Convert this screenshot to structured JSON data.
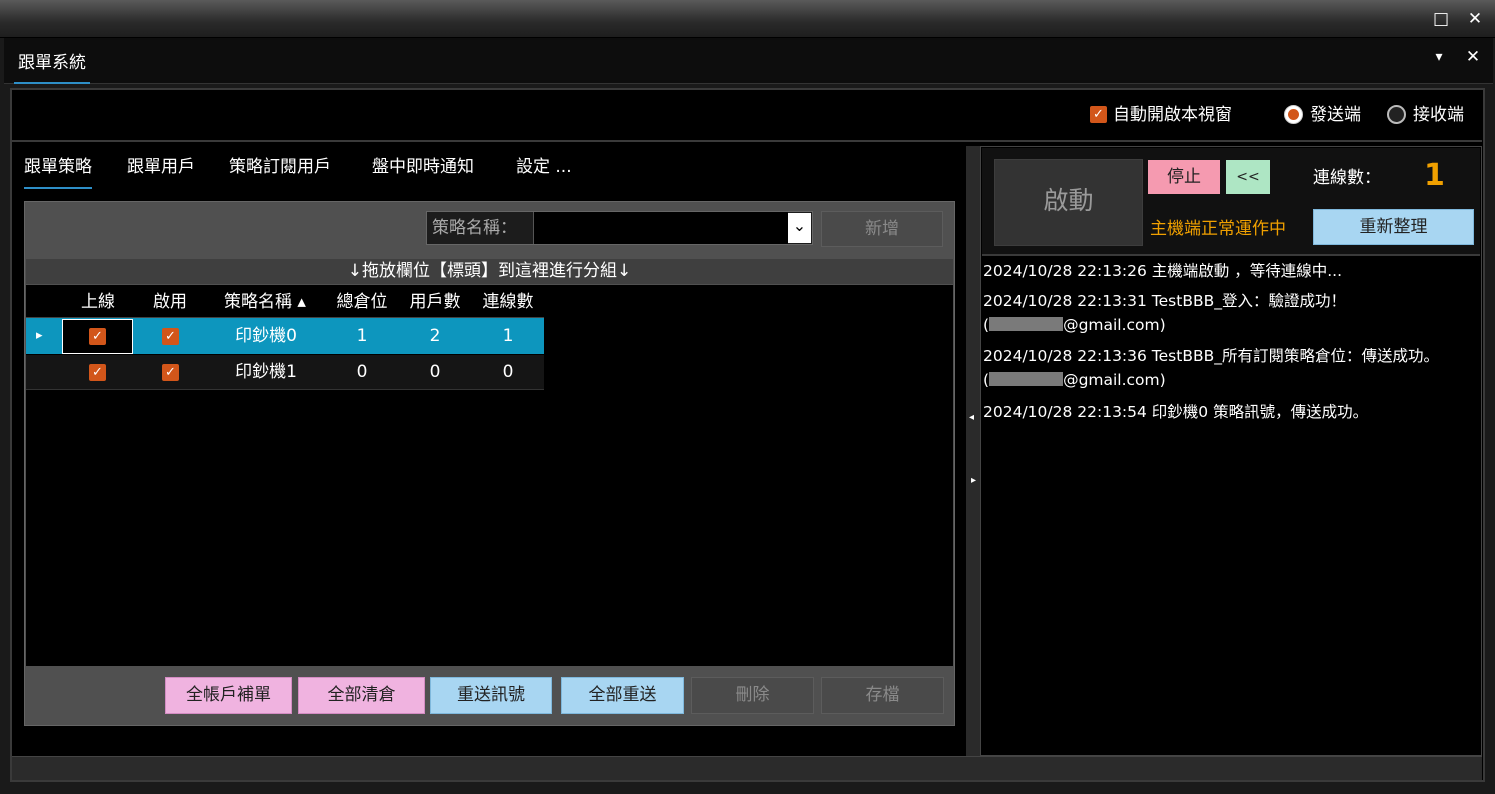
{
  "window": {
    "maximize_icon": "□",
    "close_icon": "✕"
  },
  "doc_tab": {
    "label": "跟單系統",
    "pin_icon": "▾",
    "close_icon": "✕"
  },
  "header": {
    "auto_open_label": "自動開啟本視窗",
    "sender_label": "發送端",
    "receiver_label": "接收端"
  },
  "left_tabs": [
    "跟單策略",
    "跟單用戶",
    "策略訂閱用戶",
    "盤中即時通知",
    "設定 ..."
  ],
  "strategy_filter": {
    "label": "策略名稱：",
    "value": "",
    "add_button": "新增"
  },
  "group_hint": "↓拖放欄位【標頭】到這裡進行分組↓",
  "table": {
    "columns": [
      "上線",
      "啟用",
      "策略名稱 ▴",
      "總倉位",
      "用戶數",
      "連線數"
    ],
    "rows": [
      {
        "online": true,
        "enabled": true,
        "name": "印鈔機0",
        "total_position": "1",
        "users": "2",
        "connections": "1",
        "selected": true
      },
      {
        "online": true,
        "enabled": true,
        "name": "印鈔機1",
        "total_position": "0",
        "users": "0",
        "connections": "0",
        "selected": false
      }
    ]
  },
  "bottom_buttons": {
    "fill_all": "全帳戶補單",
    "close_all": "全部清倉",
    "resend_signal": "重送訊號",
    "resend_all": "全部重送",
    "delete": "刪除",
    "save": "存檔"
  },
  "server": {
    "start_button": "啟動",
    "stop_button": "停止",
    "collapse_button": "<<",
    "connections_label": "連線數：",
    "connections_value": "1",
    "status_text": "主機端正常運作中",
    "refresh_button": "重新整理"
  },
  "log": [
    "2024/10/28 22:13:26 主機端啟動 ，等待連線中...",
    "2024/10/28 22:13:31 TestBBB_登入：驗證成功！",
    "@gmail.com)",
    "2024/10/28 22:13:36 TestBBB_所有訂閱策略倉位：傳送成功。",
    "@gmail.com)",
    "2024/10/28 22:13:54 印鈔機0 策略訊號，傳送成功。"
  ],
  "colors": {
    "accent_orange": "#d2561a",
    "selected_row": "#0d96be",
    "status_orange": "#f0a000",
    "tab_underline": "#2e8fc8"
  },
  "icons": {
    "check": "✓",
    "row_pointer": "▸",
    "dropdown": "⌄",
    "splitter_left": "◂",
    "splitter_right": "▸"
  }
}
